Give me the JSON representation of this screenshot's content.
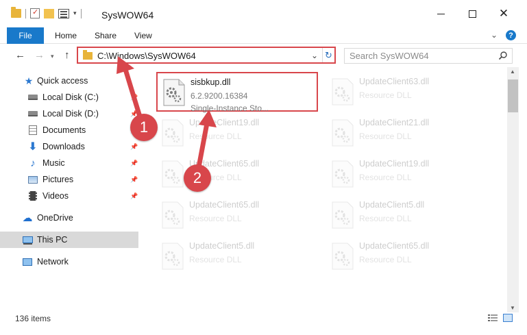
{
  "window": {
    "title": "SysWOW64",
    "minimize_glyph": "",
    "close_glyph": "✕"
  },
  "ribbon": {
    "tabs": [
      {
        "label": "File"
      },
      {
        "label": "Home"
      },
      {
        "label": "Share"
      },
      {
        "label": "View"
      }
    ],
    "help_label": "?"
  },
  "address_bar": {
    "path": "C:\\Windows\\SysWOW64"
  },
  "search": {
    "placeholder": "Search SysWOW64"
  },
  "sidebar": {
    "items": [
      {
        "label": "Quick access",
        "icon": "star-icon",
        "pinned": false
      },
      {
        "label": "Local Disk (C:)",
        "icon": "drive-icon",
        "pinned": true
      },
      {
        "label": "Local Disk (D:)",
        "icon": "drive-icon",
        "pinned": true
      },
      {
        "label": "Documents",
        "icon": "documents-icon",
        "pinned": true
      },
      {
        "label": "Downloads",
        "icon": "download-icon",
        "pinned": true
      },
      {
        "label": "Music",
        "icon": "music-icon",
        "pinned": true
      },
      {
        "label": "Pictures",
        "icon": "pictures-icon",
        "pinned": true
      },
      {
        "label": "Videos",
        "icon": "videos-icon",
        "pinned": true
      },
      {
        "label": "OneDrive",
        "icon": "cloud-icon",
        "pinned": false
      },
      {
        "label": "This PC",
        "icon": "computer-icon",
        "pinned": false,
        "selected": true
      },
      {
        "label": "Network",
        "icon": "network-icon",
        "pinned": false
      }
    ]
  },
  "files": [
    {
      "name": "sisbkup.dll",
      "line1": "6.2.9200.16384",
      "line2": "Single-Instance Sto...",
      "highlighted": true
    },
    {
      "name": "UpdateClient63.dll",
      "line1": "Resource DLL"
    },
    {
      "name": "UpdateClient19.dll",
      "line1": "Resource DLL"
    },
    {
      "name": "UpdateClient21.dll",
      "line1": "Resource DLL"
    },
    {
      "name": "UpdateClient65.dll",
      "line1": "Resource DLL"
    },
    {
      "name": "UpdateClient19.dll",
      "line1": "Resource DLL"
    },
    {
      "name": "UpdateClient65.dll",
      "line1": "Resource DLL"
    },
    {
      "name": "UpdateClient5.dll",
      "line1": "Resource DLL"
    },
    {
      "name": "UpdateClient5.dll",
      "line1": "Resource DLL"
    },
    {
      "name": "UpdateClient65.dll",
      "line1": "Resource DLL"
    }
  ],
  "status_bar": {
    "item_count": "136 items"
  },
  "annotations": {
    "step1": "1",
    "step2": "2",
    "accent_color": "#d8464b"
  },
  "colors": {
    "file_tab": "#1979ca",
    "selected_nav": "#d9d9d9",
    "folder": "#e8b43a"
  }
}
